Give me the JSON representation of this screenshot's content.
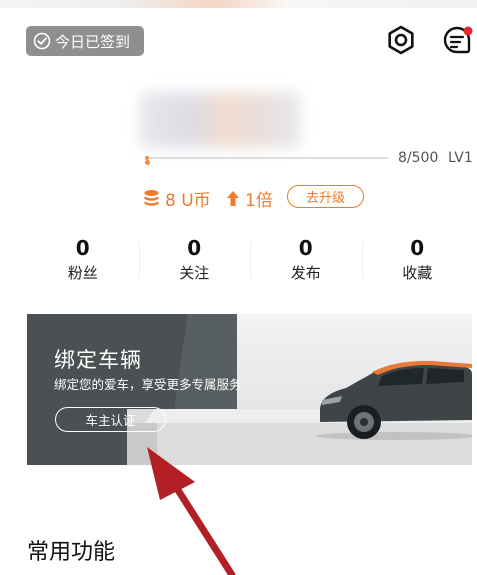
{
  "header": {
    "checkin_label": "今日已签到",
    "checkin_icon": "check-circle-icon",
    "settings_icon": "gear-icon",
    "message_icon": "message-icon",
    "notification_color": "#e8262d"
  },
  "level": {
    "progress_text": "8/500",
    "level_label": "LV1",
    "progress_fraction": 0.016
  },
  "points": {
    "coins_label": "8 U币",
    "multiplier_label": "1倍",
    "upgrade_label": "去升级",
    "accent_color": "#f07a2a"
  },
  "stats": [
    {
      "count": "0",
      "label": "粉丝"
    },
    {
      "count": "0",
      "label": "关注"
    },
    {
      "count": "0",
      "label": "发布"
    },
    {
      "count": "0",
      "label": "收藏"
    }
  ],
  "banner": {
    "title": "绑定车辆",
    "subtitle": "绑定您的爱车，享受更多专属服务",
    "button_label": "车主认证"
  },
  "section": {
    "title": "常用功能"
  },
  "annotation": {
    "arrow_color": "#b21f24"
  }
}
